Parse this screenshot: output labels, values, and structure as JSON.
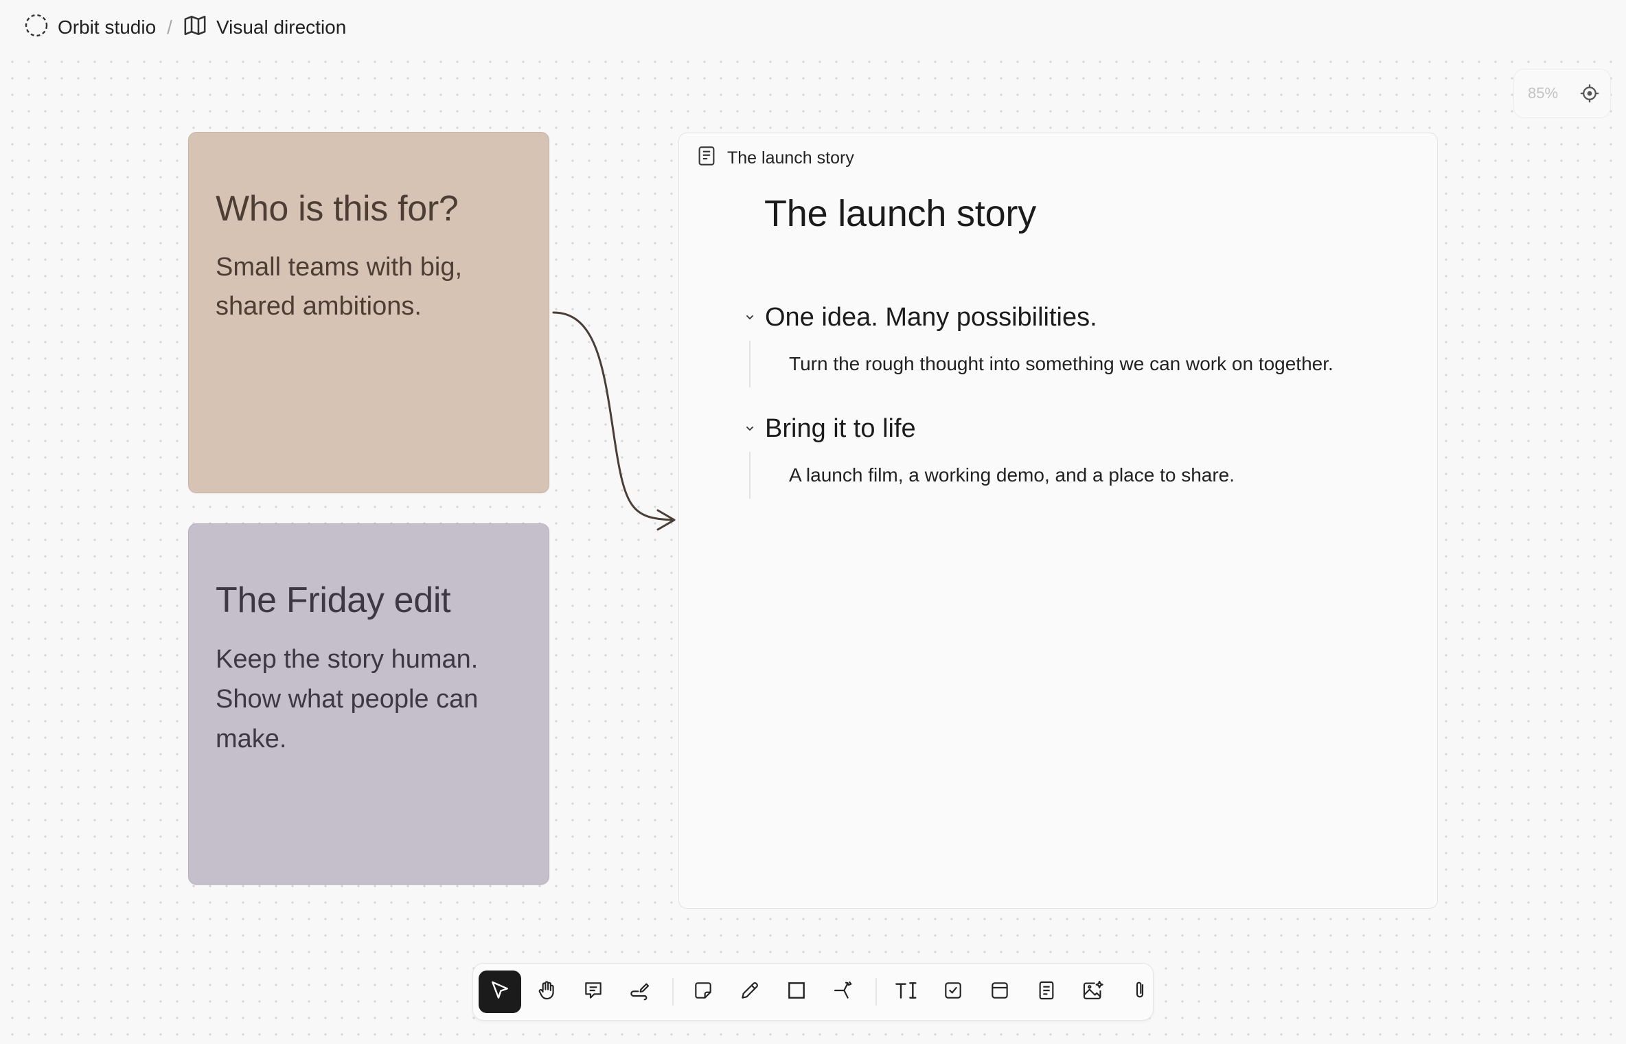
{
  "breadcrumb": {
    "workspace": "Orbit studio",
    "separator": "/",
    "page": "Visual direction"
  },
  "zoom": {
    "label": "85%"
  },
  "stickies": [
    {
      "title": "Who is this for?",
      "body": "Small teams with big, shared ambitions.",
      "color": "#d6c3b4"
    },
    {
      "title": "The Friday edit",
      "body": "Keep the story human. Show what people can make.",
      "color": "#c5bfcc"
    }
  ],
  "doc": {
    "header_label": "The launch story",
    "title": "The launch story",
    "sections": [
      {
        "heading": "One idea. Many possibilities.",
        "body": "Turn the rough thought into something we can work on together."
      },
      {
        "heading": "Bring it to life",
        "body": "A launch film, a working demo, and a place to share."
      }
    ]
  },
  "toolbar": {
    "active_tool": "select",
    "tools": [
      "select-icon",
      "hand-icon",
      "comment-icon",
      "draw-path-icon",
      "sticky-note-icon",
      "pencil-icon",
      "rectangle-icon",
      "connector-icon",
      "text-icon",
      "checkbox-icon",
      "frame-icon",
      "document-icon",
      "ai-image-icon",
      "attachment-icon"
    ]
  },
  "colors": {
    "canvas": "#f8f8f8",
    "active_tool_bg": "#1b1b1b",
    "connector": "#4a3e36"
  }
}
